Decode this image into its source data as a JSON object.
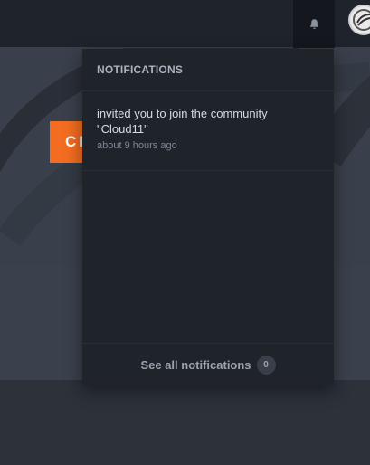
{
  "hero": {
    "cta_label": "CR"
  },
  "notifications": {
    "header": "NOTIFICATIONS",
    "items": [
      {
        "text": "invited you to join the community \"Cloud11\"",
        "time": "about 9 hours ago"
      }
    ],
    "footer_label": "See all notifications",
    "count": "0"
  },
  "icons": {
    "bell": "bell-icon",
    "avatar": "avatar"
  },
  "colors": {
    "accent": "#f26d21",
    "dropdown_bg": "#1f232a"
  }
}
